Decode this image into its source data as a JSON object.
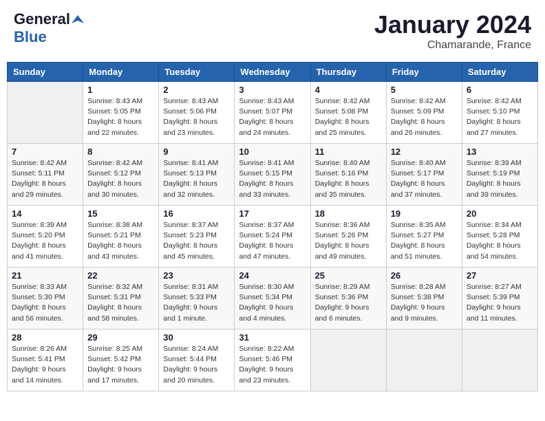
{
  "header": {
    "logo_general": "General",
    "logo_blue": "Blue",
    "month": "January 2024",
    "location": "Chamarande, France"
  },
  "days_of_week": [
    "Sunday",
    "Monday",
    "Tuesday",
    "Wednesday",
    "Thursday",
    "Friday",
    "Saturday"
  ],
  "weeks": [
    [
      {
        "day": "",
        "info": ""
      },
      {
        "day": "1",
        "info": "Sunrise: 8:43 AM\nSunset: 5:05 PM\nDaylight: 8 hours\nand 22 minutes."
      },
      {
        "day": "2",
        "info": "Sunrise: 8:43 AM\nSunset: 5:06 PM\nDaylight: 8 hours\nand 23 minutes."
      },
      {
        "day": "3",
        "info": "Sunrise: 8:43 AM\nSunset: 5:07 PM\nDaylight: 8 hours\nand 24 minutes."
      },
      {
        "day": "4",
        "info": "Sunrise: 8:42 AM\nSunset: 5:08 PM\nDaylight: 8 hours\nand 25 minutes."
      },
      {
        "day": "5",
        "info": "Sunrise: 8:42 AM\nSunset: 5:09 PM\nDaylight: 8 hours\nand 26 minutes."
      },
      {
        "day": "6",
        "info": "Sunrise: 8:42 AM\nSunset: 5:10 PM\nDaylight: 8 hours\nand 27 minutes."
      }
    ],
    [
      {
        "day": "7",
        "info": "Sunrise: 8:42 AM\nSunset: 5:11 PM\nDaylight: 8 hours\nand 29 minutes."
      },
      {
        "day": "8",
        "info": "Sunrise: 8:42 AM\nSunset: 5:12 PM\nDaylight: 8 hours\nand 30 minutes."
      },
      {
        "day": "9",
        "info": "Sunrise: 8:41 AM\nSunset: 5:13 PM\nDaylight: 8 hours\nand 32 minutes."
      },
      {
        "day": "10",
        "info": "Sunrise: 8:41 AM\nSunset: 5:15 PM\nDaylight: 8 hours\nand 33 minutes."
      },
      {
        "day": "11",
        "info": "Sunrise: 8:40 AM\nSunset: 5:16 PM\nDaylight: 8 hours\nand 35 minutes."
      },
      {
        "day": "12",
        "info": "Sunrise: 8:40 AM\nSunset: 5:17 PM\nDaylight: 8 hours\nand 37 minutes."
      },
      {
        "day": "13",
        "info": "Sunrise: 8:39 AM\nSunset: 5:19 PM\nDaylight: 8 hours\nand 39 minutes."
      }
    ],
    [
      {
        "day": "14",
        "info": "Sunrise: 8:39 AM\nSunset: 5:20 PM\nDaylight: 8 hours\nand 41 minutes."
      },
      {
        "day": "15",
        "info": "Sunrise: 8:38 AM\nSunset: 5:21 PM\nDaylight: 8 hours\nand 43 minutes."
      },
      {
        "day": "16",
        "info": "Sunrise: 8:37 AM\nSunset: 5:23 PM\nDaylight: 8 hours\nand 45 minutes."
      },
      {
        "day": "17",
        "info": "Sunrise: 8:37 AM\nSunset: 5:24 PM\nDaylight: 8 hours\nand 47 minutes."
      },
      {
        "day": "18",
        "info": "Sunrise: 8:36 AM\nSunset: 5:26 PM\nDaylight: 8 hours\nand 49 minutes."
      },
      {
        "day": "19",
        "info": "Sunrise: 8:35 AM\nSunset: 5:27 PM\nDaylight: 8 hours\nand 51 minutes."
      },
      {
        "day": "20",
        "info": "Sunrise: 8:34 AM\nSunset: 5:28 PM\nDaylight: 8 hours\nand 54 minutes."
      }
    ],
    [
      {
        "day": "21",
        "info": "Sunrise: 8:33 AM\nSunset: 5:30 PM\nDaylight: 8 hours\nand 56 minutes."
      },
      {
        "day": "22",
        "info": "Sunrise: 8:32 AM\nSunset: 5:31 PM\nDaylight: 8 hours\nand 58 minutes."
      },
      {
        "day": "23",
        "info": "Sunrise: 8:31 AM\nSunset: 5:33 PM\nDaylight: 9 hours\nand 1 minute."
      },
      {
        "day": "24",
        "info": "Sunrise: 8:30 AM\nSunset: 5:34 PM\nDaylight: 9 hours\nand 4 minutes."
      },
      {
        "day": "25",
        "info": "Sunrise: 8:29 AM\nSunset: 5:36 PM\nDaylight: 9 hours\nand 6 minutes."
      },
      {
        "day": "26",
        "info": "Sunrise: 8:28 AM\nSunset: 5:38 PM\nDaylight: 9 hours\nand 9 minutes."
      },
      {
        "day": "27",
        "info": "Sunrise: 8:27 AM\nSunset: 5:39 PM\nDaylight: 9 hours\nand 11 minutes."
      }
    ],
    [
      {
        "day": "28",
        "info": "Sunrise: 8:26 AM\nSunset: 5:41 PM\nDaylight: 9 hours\nand 14 minutes."
      },
      {
        "day": "29",
        "info": "Sunrise: 8:25 AM\nSunset: 5:42 PM\nDaylight: 9 hours\nand 17 minutes."
      },
      {
        "day": "30",
        "info": "Sunrise: 8:24 AM\nSunset: 5:44 PM\nDaylight: 9 hours\nand 20 minutes."
      },
      {
        "day": "31",
        "info": "Sunrise: 8:22 AM\nSunset: 5:46 PM\nDaylight: 9 hours\nand 23 minutes."
      },
      {
        "day": "",
        "info": ""
      },
      {
        "day": "",
        "info": ""
      },
      {
        "day": "",
        "info": ""
      }
    ]
  ]
}
